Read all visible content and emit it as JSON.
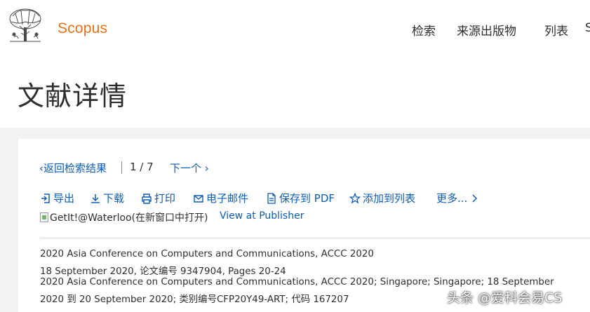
{
  "header": {
    "brand": "Scopus",
    "nav": [
      {
        "label": "检索"
      },
      {
        "label": "来源出版物"
      },
      {
        "label": "列表"
      },
      {
        "label": "S"
      }
    ]
  },
  "page": {
    "title": "文献详情"
  },
  "pager": {
    "back_label": "返回检索结果",
    "count": "1 / 7",
    "next_label": "下一个"
  },
  "toolbar": {
    "items": [
      {
        "label": "导出",
        "icon": "export-icon"
      },
      {
        "label": "下载",
        "icon": "download-icon"
      },
      {
        "label": "打印",
        "icon": "print-icon"
      },
      {
        "label": "电子邮件",
        "icon": "email-icon"
      },
      {
        "label": "保存到 PDF",
        "icon": "pdf-icon"
      },
      {
        "label": "添加到列表",
        "icon": "star-icon"
      },
      {
        "label": "更多...",
        "icon": "chevron-right-icon"
      }
    ]
  },
  "links": {
    "getit_alt": "GetIt!@Waterloo(在新窗口中打开)",
    "publisher": "View at Publisher"
  },
  "document": {
    "line1": "2020 Asia Conference on Computers and Communications, ACCC 2020",
    "line2": "18 September 2020, 论文编号 9347904, Pages 20-24",
    "line3": "2020 Asia Conference on Computers and Communications, ACCC 2020; Singapore; Singapore; 18 September",
    "line4": "2020 到 20 September 2020; 类别编号CFP20Y49-ART; 代码 167207"
  },
  "watermark": "头条 @爱科会易CS",
  "colors": {
    "brand": "#e9711c",
    "link": "#0c5cb4",
    "text": "#2e2e2e",
    "background": "#f2f2f2"
  }
}
